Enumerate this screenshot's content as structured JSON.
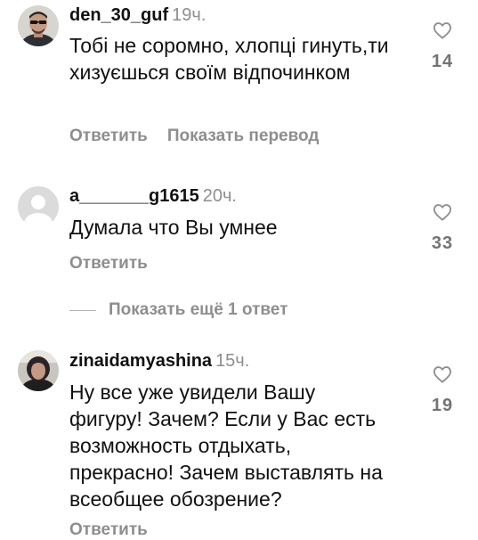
{
  "comments": [
    {
      "username": "den_30_guf",
      "time": "19ч.",
      "text": "Тобі не соромно, хлопці гинуть,ти хизуєшься своїм відпочинком",
      "reply_label": "Ответить",
      "translate_label": "Показать перевод",
      "likes": "14",
      "avatar_icon": "avatar-man-with-sunglasses"
    },
    {
      "username": "a_______g1615",
      "time": "20ч.",
      "text": "Думала что Вы умнее",
      "reply_label": "Ответить",
      "likes": "33",
      "avatar_icon": "default-avatar-silhouette"
    },
    {
      "username": "zinaidamyashina",
      "time": "15ч.",
      "text": "Ну все уже увидели Вашу фигуру! Зачем?  Если у Вас есть возможность отдыхать, прекрасно! Зачем выставлять на всеобщее обозрение?",
      "reply_label": "Ответить",
      "likes": "19",
      "avatar_icon": "avatar-woman-photo"
    }
  ],
  "more_replies_label": "Показать ещё 1 ответ",
  "icons": {
    "like": "heart-outline-icon"
  },
  "colors": {
    "text": "#111111",
    "secondary": "#8e8e8e",
    "background": "#ffffff"
  }
}
